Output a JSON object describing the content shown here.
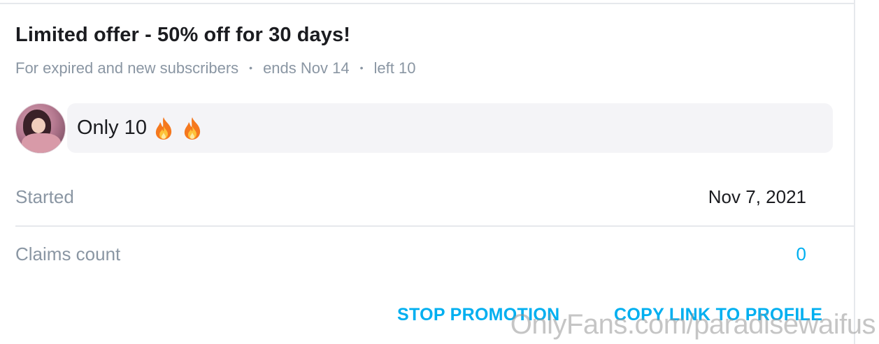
{
  "offer": {
    "title": "Limited offer - 50% off for 30 days!",
    "audience": "For expired and new subscribers",
    "ends": "ends Nov 14",
    "left": "left 10",
    "separator": "•"
  },
  "message": {
    "text": "Only 10",
    "emoji_icons": [
      "fire-icon",
      "fire-icon"
    ]
  },
  "details": {
    "started_label": "Started",
    "started_value": "Nov 7, 2021",
    "claims_label": "Claims count",
    "claims_value": "0"
  },
  "actions": {
    "stop_label": "STOP PROMOTION",
    "copy_label": "COPY LINK TO PROFILE"
  },
  "watermark": "OnlyFans.com/paradisewaifus",
  "colors": {
    "accent": "#00aff0",
    "muted": "#8a96a3",
    "text": "#1b1c20",
    "message_bg": "#f4f4f7"
  }
}
